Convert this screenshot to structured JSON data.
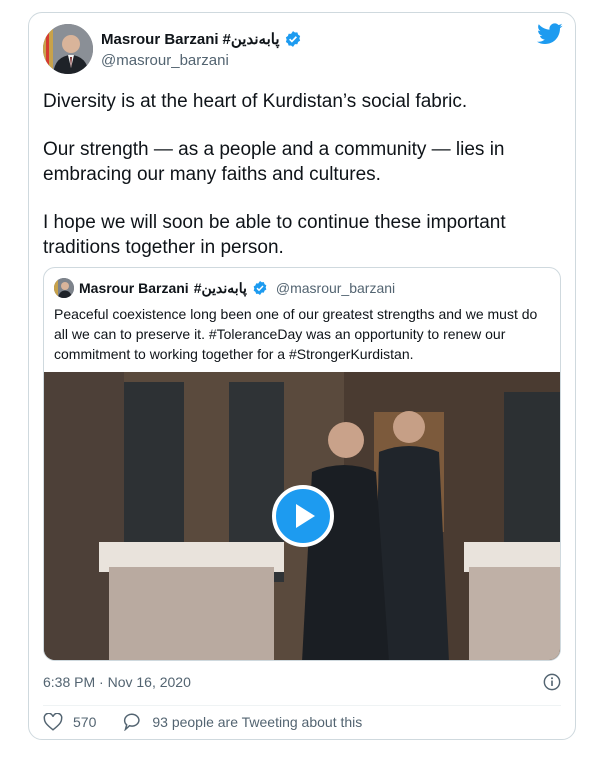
{
  "author": {
    "name": "Masrour Barzani",
    "hashtag": "#پابەندین",
    "handle": "@masrour_barzani"
  },
  "tweet": {
    "paragraphs": [
      "Diversity is at the heart of Kurdistan’s social fabric.",
      "Our strength — as a people and a community — lies in\nembracing our many faiths and cultures.",
      "I hope we will soon be able to continue these important\ntraditions together in person."
    ]
  },
  "quoted": {
    "name": "Masrour Barzani",
    "hashtag": "#پابەندین",
    "handle": "@masrour_barzani",
    "text": "Peaceful coexistence long been one of our greatest strengths and we must do all we can to preserve it. #ToleranceDay was an opportunity to renew our commitment to working together for a #StrongerKurdistan."
  },
  "meta": {
    "timestamp": "6:38 PM · Nov 16, 2020"
  },
  "actions": {
    "likes": "570",
    "tweeting": "93 people are Tweeting about this"
  },
  "colors": {
    "accent": "#1d9bf0",
    "verified": "#1d9bf0"
  },
  "icons": [
    "twitter-bird-icon",
    "verified-icon",
    "play-icon",
    "info-icon",
    "heart-icon",
    "comment-icon"
  ]
}
